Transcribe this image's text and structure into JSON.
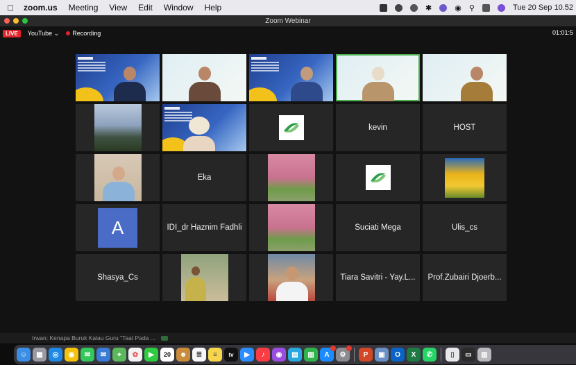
{
  "menubar": {
    "app": "zoom.us",
    "items": [
      "Meeting",
      "View",
      "Edit",
      "Window",
      "Help"
    ],
    "clock": "Tue 20 Sep  10.52"
  },
  "window": {
    "title": "Zoom Webinar",
    "live_label": "LIVE",
    "stream_label": "YouTube",
    "recording_label": "Recording",
    "timer": "01:01:5"
  },
  "participants": [
    {
      "type": "video"
    },
    {
      "type": "video"
    },
    {
      "type": "video"
    },
    {
      "type": "video"
    },
    {
      "type": "video"
    },
    {
      "type": "photo",
      "image": "mountain"
    },
    {
      "type": "video"
    },
    {
      "type": "logo"
    },
    {
      "type": "name",
      "name": "kevin"
    },
    {
      "type": "name",
      "name": "HOST"
    },
    {
      "type": "photo",
      "image": "man-portrait"
    },
    {
      "type": "name",
      "name": "Eka"
    },
    {
      "type": "photo",
      "image": "trees"
    },
    {
      "type": "logo"
    },
    {
      "type": "photo",
      "image": "tulips"
    },
    {
      "type": "avatar",
      "letter": "A"
    },
    {
      "type": "name",
      "name": "IDI_dr Haznim Fadhli"
    },
    {
      "type": "photo",
      "image": "trees"
    },
    {
      "type": "name",
      "name": "Suciati Mega"
    },
    {
      "type": "name",
      "name": "Ulis_cs"
    },
    {
      "type": "name",
      "name": "Shasya_Cs"
    },
    {
      "type": "photo",
      "image": "outdoor"
    },
    {
      "type": "photo",
      "image": "selfie"
    },
    {
      "type": "name",
      "name": "Tiara Savitri - Yay.L..."
    },
    {
      "type": "name",
      "name": "Prof.Zubairi Djoerb..."
    }
  ],
  "chat_preview": "Irwan: Kenapa Buruk Kalau Guru \"Taat Pada ...",
  "dock": {
    "calendar_day": "20",
    "tv_label": "tv",
    "icons": [
      "finder-icon",
      "launchpad-icon",
      "safari-icon",
      "chrome-icon",
      "messages-icon",
      "mail-icon",
      "maps-icon",
      "photos-icon",
      "facetime-icon",
      "calendar-icon",
      "contacts-icon",
      "reminders-icon",
      "notes-icon",
      "tv-icon",
      "zoom-icon",
      "music-icon",
      "podcasts-icon",
      "keynote-icon",
      "numbers-icon",
      "appstore-icon",
      "settings-icon",
      "powerpoint-icon",
      "preview-icon",
      "outlook-icon",
      "excel-icon",
      "whatsapp-icon",
      "files-icon",
      "trash-icon"
    ]
  }
}
